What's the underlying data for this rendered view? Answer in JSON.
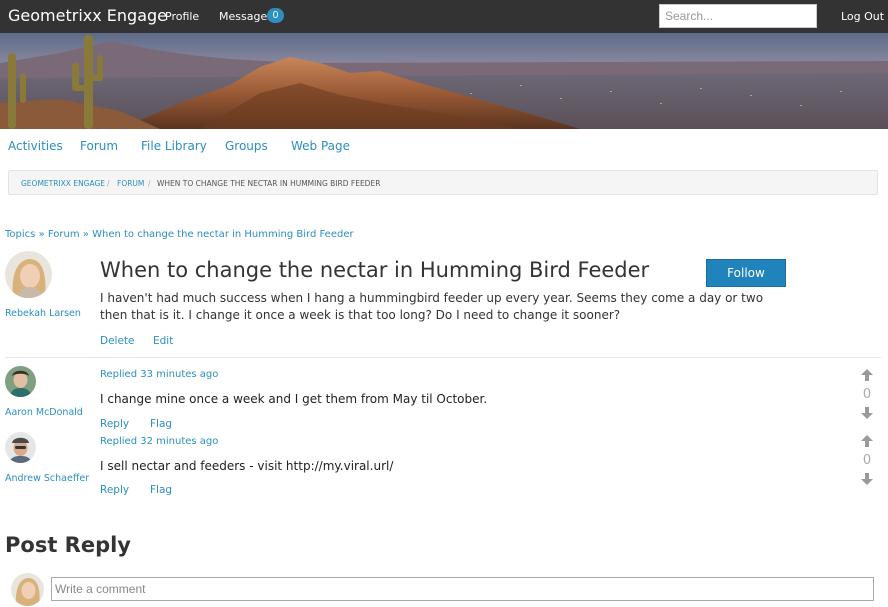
{
  "header": {
    "brand": "Geometrixx Engage",
    "profile_label": "Profile",
    "messages_label": "Messages",
    "messages_count": "0",
    "search_placeholder": "Search...",
    "logout_label": "Log Out"
  },
  "subnav": {
    "items": [
      "Activities",
      "Forum",
      "File Library",
      "Groups",
      "Web Page"
    ]
  },
  "breadcrumb": {
    "items": [
      "GEOMETRIXX ENGAGE",
      "FORUM",
      "WHEN TO CHANGE THE NECTAR IN HUMMING BIRD FEEDER"
    ],
    "separator": "/"
  },
  "topic_path": {
    "topics": "Topics",
    "sep": "»",
    "forum": "Forum",
    "current": "When to change the nectar in Humming Bird Feeder"
  },
  "post": {
    "author": "Rebekah Larsen",
    "title": "When to change the nectar in Humming Bird Feeder",
    "follow_label": "Follow",
    "body": "I haven't had much success when I hang a hummingbird feeder up every year. Seems they come a day or two then that is it. I change it once a week is that too long? Do I need to change it sooner?",
    "delete_label": "Delete",
    "edit_label": "Edit"
  },
  "replies": [
    {
      "author": "Aaron McDonald",
      "time": "Replied 33 minutes ago",
      "body": "I change mine once a week and I get them from May til October.",
      "reply_label": "Reply",
      "flag_label": "Flag",
      "votes": "0"
    },
    {
      "author": "Andrew Schaeffer",
      "time": "Replied 32 minutes ago",
      "body": "I sell nectar and feeders - visit http://my.viral.url/",
      "reply_label": "Reply",
      "flag_label": "Flag",
      "votes": "0"
    }
  ],
  "post_reply": {
    "heading": "Post Reply",
    "placeholder": "Write a comment"
  },
  "colors": {
    "topbar": "#333333",
    "link": "#2b8fc0",
    "follow_button": "#2083bb",
    "badge": "#2b8fc0"
  },
  "icons": {
    "vote_up": "arrow-up-icon",
    "vote_down": "arrow-down-icon"
  }
}
